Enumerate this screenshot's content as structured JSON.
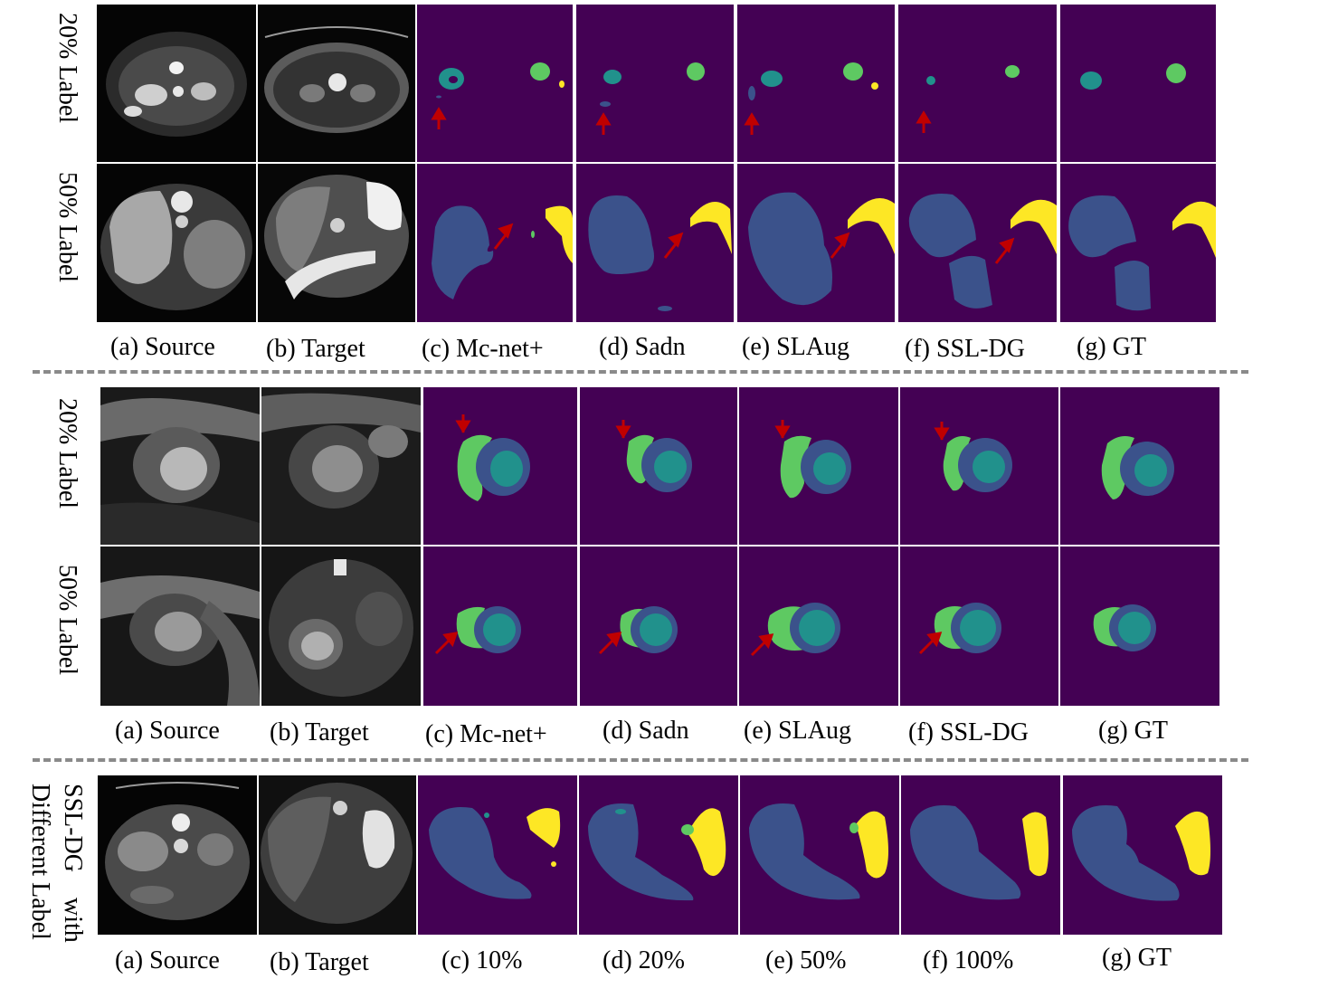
{
  "colors": {
    "background": "#440154",
    "class_blue": "#3b528b",
    "class_teal": "#21918c",
    "class_green": "#5ec962",
    "class_yellow": "#fde725",
    "arrow": "#c00000",
    "divider": "#8a8a8a"
  },
  "panels": [
    {
      "rows": [
        "20% Label",
        "50% Label"
      ],
      "captions": [
        "(a) Source",
        "(b) Target",
        "(c) Mc-net+",
        "(d) Sadn",
        "(e) SLAug",
        "(f) SSL-DG",
        "(g) GT"
      ]
    },
    {
      "rows": [
        "20% Label",
        "50% Label"
      ],
      "captions": [
        "(a) Source",
        "(b) Target",
        "(c) Mc-net+",
        "(d) Sadn",
        "(e) SLAug",
        "(f) SSL-DG",
        "(g) GT"
      ]
    },
    {
      "rows": [
        "SSL-DG    with",
        "Different Label"
      ],
      "captions": [
        "(a) Source",
        "(b) Target",
        "(c) 10%",
        "(d) 20%",
        "(e) 50%",
        "(f) 100%",
        "(g) GT"
      ]
    }
  ]
}
